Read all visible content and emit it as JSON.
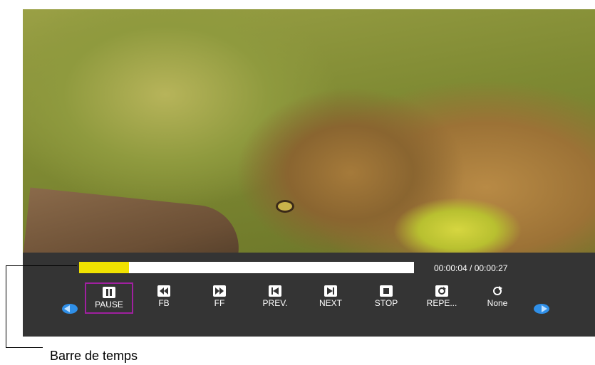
{
  "playback": {
    "progress_fraction": 0.148,
    "time_display": "00:00:04 / 00:00:27"
  },
  "controls": [
    {
      "label": "PAUSE",
      "icon": "pause-icon",
      "selected": true
    },
    {
      "label": "FB",
      "icon": "fast-backward-icon"
    },
    {
      "label": "FF",
      "icon": "fast-forward-icon"
    },
    {
      "label": "PREV.",
      "icon": "previous-icon"
    },
    {
      "label": "NEXT",
      "icon": "next-icon"
    },
    {
      "label": "STOP",
      "icon": "stop-icon"
    },
    {
      "label": "REPE...",
      "icon": "repeat-icon"
    },
    {
      "label": "None",
      "icon": "ab-repeat-icon"
    }
  ],
  "callout": {
    "label": "Barre de temps"
  },
  "colors": {
    "progress": "#f0e200",
    "selection": "#a020a0",
    "panel": "#343434",
    "nav_arrow": "#2f8fe8"
  }
}
